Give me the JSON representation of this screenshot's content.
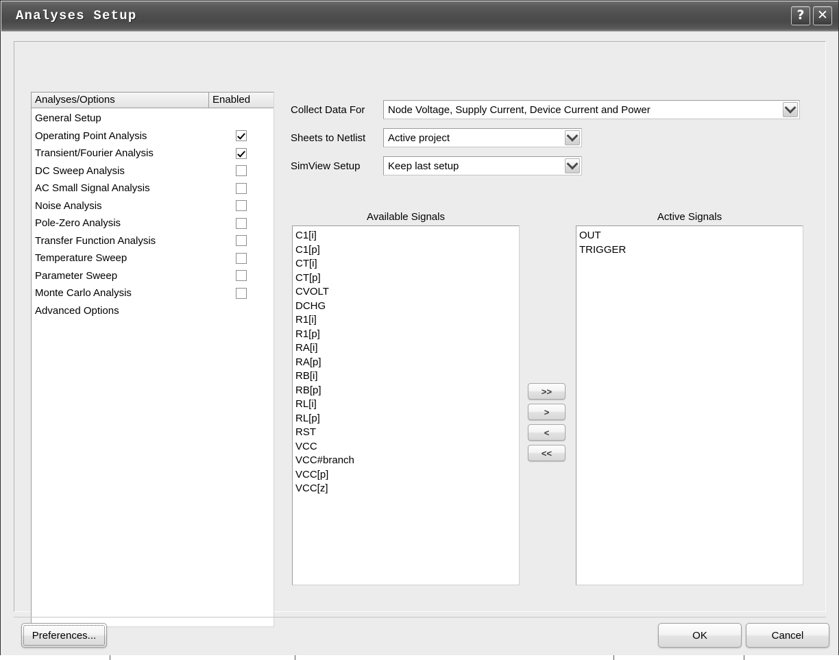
{
  "window": {
    "title": "Analyses Setup",
    "help_button": "?",
    "close_button": "✕"
  },
  "analyses_table": {
    "headers": {
      "name": "Analyses/Options",
      "enabled": "Enabled"
    },
    "rows": [
      {
        "label": "General Setup",
        "enabled": null
      },
      {
        "label": "Operating Point Analysis",
        "enabled": true
      },
      {
        "label": "Transient/Fourier Analysis",
        "enabled": true
      },
      {
        "label": "DC Sweep Analysis",
        "enabled": false
      },
      {
        "label": "AC Small Signal Analysis",
        "enabled": false
      },
      {
        "label": "Noise Analysis",
        "enabled": false
      },
      {
        "label": "Pole-Zero Analysis",
        "enabled": false
      },
      {
        "label": "Transfer Function Analysis",
        "enabled": false
      },
      {
        "label": "Temperature Sweep",
        "enabled": false
      },
      {
        "label": "Parameter Sweep",
        "enabled": false
      },
      {
        "label": "Monte Carlo Analysis",
        "enabled": false
      },
      {
        "label": "Advanced Options",
        "enabled": null
      }
    ]
  },
  "form": {
    "collect_data_for": {
      "label": "Collect Data For",
      "value": "Node Voltage, Supply Current, Device Current and Power"
    },
    "sheets_to_netlist": {
      "label": "Sheets to Netlist",
      "value": "Active project"
    },
    "simview_setup": {
      "label": "SimView Setup",
      "value": "Keep last setup"
    }
  },
  "signals": {
    "available_title": "Available Signals",
    "active_title": "Active Signals",
    "available": [
      "C1[i]",
      "C1[p]",
      "CT[i]",
      "CT[p]",
      "CVOLT",
      "DCHG",
      "R1[i]",
      "R1[p]",
      "RA[i]",
      "RA[p]",
      "RB[i]",
      "RB[p]",
      "RL[i]",
      "RL[p]",
      "RST",
      "VCC",
      "VCC#branch",
      "VCC[p]",
      "VCC[z]"
    ],
    "active": [
      "OUT",
      "TRIGGER"
    ],
    "transfer_buttons": [
      {
        "name": "add-all",
        "label": ">>"
      },
      {
        "name": "add-one",
        "label": ">"
      },
      {
        "name": "remove-one",
        "label": "<"
      },
      {
        "name": "remove-all",
        "label": "<<"
      }
    ]
  },
  "footer": {
    "preferences": "Preferences...",
    "ok": "OK",
    "cancel": "Cancel"
  },
  "colors": {
    "titlebar_dark": "#4e4e4e",
    "dialog_bg": "#ececec",
    "field_bg": "#ffffff",
    "border": "#9b9b9b"
  }
}
